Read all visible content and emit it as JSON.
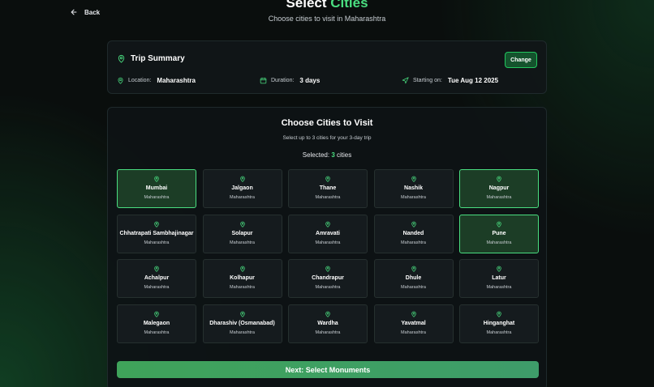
{
  "nav": {
    "back_label": "Back"
  },
  "header": {
    "title_plain": "Select",
    "title_accent": "Cities",
    "subtitle": "Choose cities to visit in Maharashtra"
  },
  "summary": {
    "title": "Trip Summary",
    "change_label": "Change",
    "location_label": "Location:",
    "location_value": "Maharashtra",
    "duration_label": "Duration:",
    "duration_value": "3 days",
    "start_label": "Starting on:",
    "start_value": "Tue Aug 12 2025"
  },
  "panel": {
    "title": "Choose Cities to Visit",
    "subtitle": "Select up to 3 cities for your 3-day trip",
    "selected_label": "Selected:",
    "selected_count": "3",
    "selected_suffix": "cities"
  },
  "cities": [
    {
      "name": "Mumbai",
      "state": "Maharashtra",
      "selected": true
    },
    {
      "name": "Jalgaon",
      "state": "Maharashtra",
      "selected": false
    },
    {
      "name": "Thane",
      "state": "Maharashtra",
      "selected": false
    },
    {
      "name": "Nashik",
      "state": "Maharashtra",
      "selected": false
    },
    {
      "name": "Nagpur",
      "state": "Maharashtra",
      "selected": true
    },
    {
      "name": "Chhatrapati Sambhajinagar",
      "state": "Maharashtra",
      "selected": false
    },
    {
      "name": "Solapur",
      "state": "Maharashtra",
      "selected": false
    },
    {
      "name": "Amravati",
      "state": "Maharashtra",
      "selected": false
    },
    {
      "name": "Nanded",
      "state": "Maharashtra",
      "selected": false
    },
    {
      "name": "Pune",
      "state": "Maharashtra",
      "selected": true
    },
    {
      "name": "Achalpur",
      "state": "Maharashtra",
      "selected": false
    },
    {
      "name": "Kolhapur",
      "state": "Maharashtra",
      "selected": false
    },
    {
      "name": "Chandrapur",
      "state": "Maharashtra",
      "selected": false
    },
    {
      "name": "Dhule",
      "state": "Maharashtra",
      "selected": false
    },
    {
      "name": "Latur",
      "state": "Maharashtra",
      "selected": false
    },
    {
      "name": "Malegaon",
      "state": "Maharashtra",
      "selected": false
    },
    {
      "name": "Dharashiv (Osmanabad)",
      "state": "Maharashtra",
      "selected": false
    },
    {
      "name": "Wardha",
      "state": "Maharashtra",
      "selected": false
    },
    {
      "name": "Yavatmal",
      "state": "Maharashtra",
      "selected": false
    },
    {
      "name": "Hinganghat",
      "state": "Maharashtra",
      "selected": false
    }
  ],
  "next_label": "Next: Select Monuments",
  "icons": {
    "back": "arrow-left-icon",
    "summary": "map-pin-icon",
    "location": "map-pin-icon",
    "duration": "calendar-icon",
    "start": "navigation-icon",
    "city": "map-pin-icon"
  },
  "colors": {
    "accent": "#4ade80",
    "selected_bg": "#1c3d26",
    "button": "#3fa35a"
  }
}
